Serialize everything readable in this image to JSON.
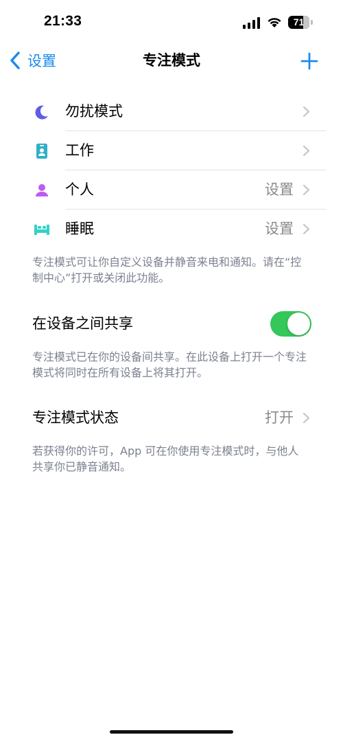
{
  "status_bar": {
    "time": "21:33",
    "battery_level": "71",
    "battery_fraction": 0.71
  },
  "nav": {
    "back_label": "设置",
    "title": "专注模式",
    "add_icon": "plus-icon",
    "back_icon": "chevron-left-icon"
  },
  "focus_modes": [
    {
      "label": "勿扰模式",
      "value": "",
      "icon": "moon-icon",
      "color": "#5e5ce6"
    },
    {
      "label": "工作",
      "value": "",
      "icon": "id-badge-icon",
      "color": "#30b0c7"
    },
    {
      "label": "个人",
      "value": "设置",
      "icon": "person-icon",
      "color": "#bf5af2"
    },
    {
      "label": "睡眠",
      "value": "设置",
      "icon": "bed-icon",
      "color": "#32d2c8"
    }
  ],
  "focus_footnote": "专注模式可让你自定义设备并静音来电和通知。请在“控制中心”打开或关闭此功能。",
  "share_across_devices": {
    "label": "在设备之间共享",
    "enabled": true,
    "footnote": "专注模式已在你的设备间共享。在此设备上打开一个专注模式将同时在所有设备上将其打开。"
  },
  "focus_status": {
    "label": "专注模式状态",
    "value": "打开",
    "footnote": "若获得你的许可，App 可在你使用专注模式时，与他人共享你已静音通知。"
  },
  "colors": {
    "accent": "#1a8af0",
    "toggle_on": "#34c759",
    "secondary_text": "#8a8a8e",
    "footnote_text": "#7c8190"
  }
}
